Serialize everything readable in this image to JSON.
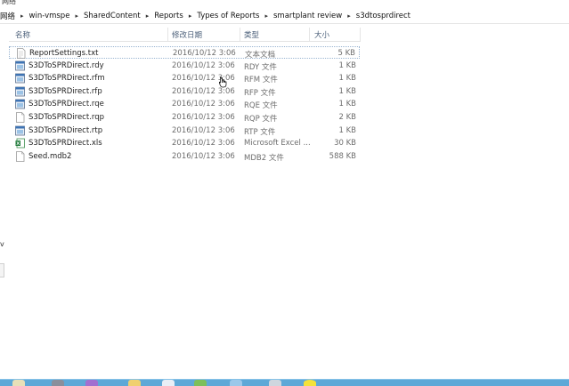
{
  "top_fragment": "网络",
  "breadcrumb": [
    "win-vmspe",
    "SharedContent",
    "Reports",
    "Types of Reports",
    "smartplant review",
    "s3dtosprdirect"
  ],
  "breadcrumb_lead": "网络",
  "columns": {
    "name": "名称",
    "date": "修改日期",
    "type": "类型",
    "size": "大小"
  },
  "files": [
    {
      "name": "ReportSettings.txt",
      "date": "2016/10/12 3:06",
      "type": "文本文档",
      "size": "5 KB",
      "icon": "text-file-icon",
      "selected": true
    },
    {
      "name": "S3DToSPRDirect.rdy",
      "date": "2016/10/12 3:06",
      "type": "RDY 文件",
      "size": "1 KB",
      "icon": "app-file-icon"
    },
    {
      "name": "S3DToSPRDirect.rfm",
      "date": "2016/10/12 3:06",
      "type": "RFM 文件",
      "size": "1 KB",
      "icon": "app-file-icon"
    },
    {
      "name": "S3DToSPRDirect.rfp",
      "date": "2016/10/12 3:06",
      "type": "RFP 文件",
      "size": "1 KB",
      "icon": "app-file-icon"
    },
    {
      "name": "S3DToSPRDirect.rqe",
      "date": "2016/10/12 3:06",
      "type": "RQE 文件",
      "size": "1 KB",
      "icon": "app-file-icon"
    },
    {
      "name": "S3DToSPRDirect.rqp",
      "date": "2016/10/12 3:06",
      "type": "RQP 文件",
      "size": "2 KB",
      "icon": "blank-file-icon"
    },
    {
      "name": "S3DToSPRDirect.rtp",
      "date": "2016/10/12 3:06",
      "type": "RTP 文件",
      "size": "1 KB",
      "icon": "app-file-icon"
    },
    {
      "name": "S3DToSPRDirect.xls",
      "date": "2016/10/12 3:06",
      "type": "Microsoft Excel ...",
      "size": "30 KB",
      "icon": "excel-file-icon"
    },
    {
      "name": "Seed.mdb2",
      "date": "2016/10/12 3:06",
      "type": "MDB2 文件",
      "size": "588 KB",
      "icon": "blank-file-icon"
    }
  ],
  "left_fragment": "v",
  "colors": {
    "header_text": "#4c607a",
    "taskbar": "#5ea8d7",
    "selection_border": "#99b4d1"
  }
}
